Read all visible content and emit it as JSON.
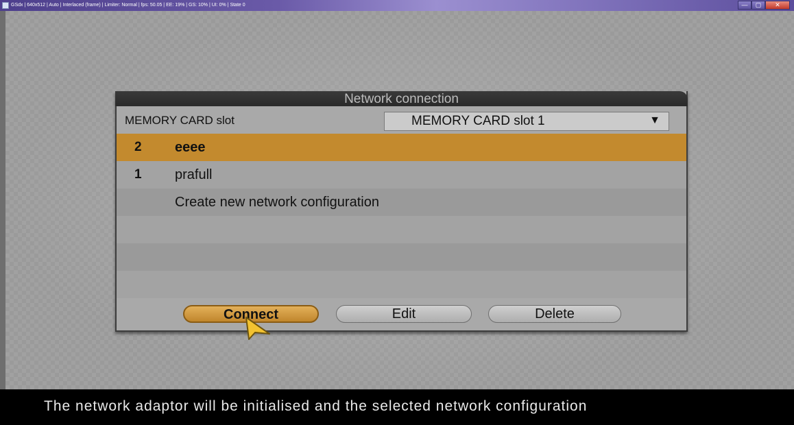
{
  "window": {
    "title": "GSdx | 640x512 | Auto | Interlaced (frame) | Limiter: Normal | fps: 50.05 | EE: 19% | GS: 10% | UI: 0% | State 0",
    "controls": {
      "minimize": "—",
      "maximize": "▢",
      "close": "✕"
    }
  },
  "dialog": {
    "title": "Network connection",
    "slot_label": "MEMORY CARD slot",
    "slot_value": "MEMORY CARD slot 1",
    "slot_arrow": "▼",
    "entries": [
      {
        "num": "2",
        "name": "eeee",
        "selected": true
      },
      {
        "num": "1",
        "name": "prafull"
      },
      {
        "num": "",
        "name": "Create new network configuration"
      }
    ],
    "buttons": {
      "connect": "Connect",
      "edit": "Edit",
      "delete": "Delete"
    }
  },
  "help_text": "The network adaptor will be initialised and the selected network configuration",
  "colors": {
    "selected_row": "#c38a2e",
    "title_bar": "#2a2a2a",
    "help_bar": "#000000"
  }
}
